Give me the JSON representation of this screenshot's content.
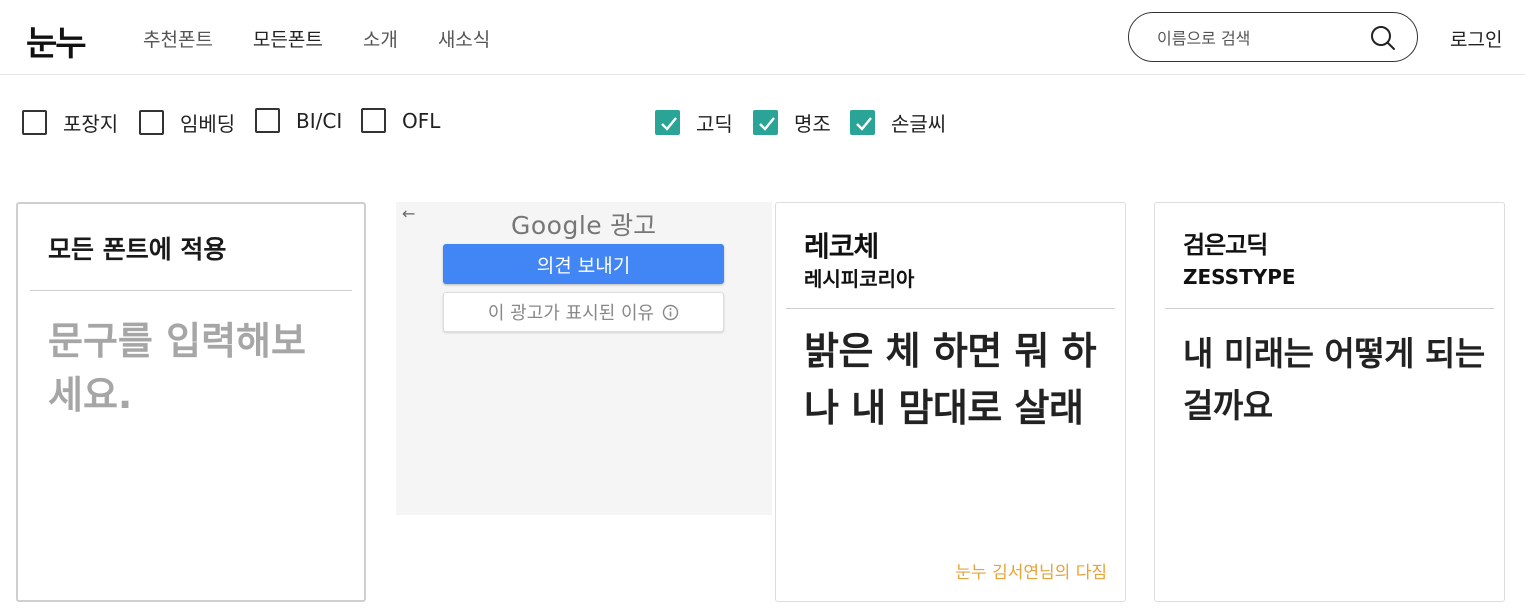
{
  "header": {
    "logo": "눈누",
    "nav": [
      {
        "label": "추천폰트",
        "active": false
      },
      {
        "label": "모든폰트",
        "active": true
      },
      {
        "label": "소개",
        "active": false
      },
      {
        "label": "새소식",
        "active": false
      }
    ],
    "search_placeholder": "이름으로 검색",
    "search_icon": "search-icon",
    "login": "로그인"
  },
  "filters": {
    "license": [
      {
        "label": "포장지",
        "checked": false
      },
      {
        "label": "임베딩",
        "checked": false
      },
      {
        "label": "BI/CI",
        "checked": false
      },
      {
        "label": "OFL",
        "checked": false
      }
    ],
    "styles": [
      {
        "label": "고딕",
        "checked": true
      },
      {
        "label": "명조",
        "checked": true
      },
      {
        "label": "손글씨",
        "checked": true
      }
    ],
    "check_color": "#2aa496"
  },
  "input_card": {
    "title": "모든 폰트에 적용",
    "placeholder": "문구를 입력해보세요."
  },
  "ad": {
    "back_icon": "←",
    "google": "Google",
    "ad_label": "광고",
    "feedback_button": "의견 보내기",
    "why_button": "이 광고가 표시된 이유",
    "button_color": "#4285f4"
  },
  "font_cards": [
    {
      "name": "레코체",
      "maker": "레시피코리아",
      "preview": "밝은 체 하면 뭐 하나 내 맘대로 살래",
      "credit": "눈누 김서연님의 다짐"
    },
    {
      "name": "검은고딕",
      "maker": "ZESSTYPE",
      "preview": "내 미래는 어떻게 되는 걸까요",
      "credit": ""
    }
  ],
  "credit_color": "#e8a33a"
}
